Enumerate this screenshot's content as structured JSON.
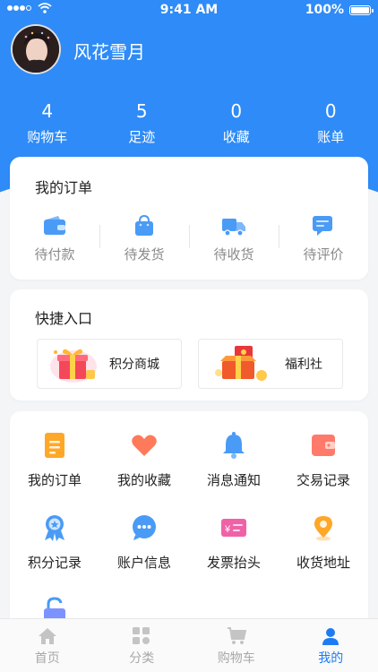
{
  "status_bar": {
    "time": "9:41 AM",
    "battery": "100%"
  },
  "profile": {
    "username": "风花雪月"
  },
  "stats": [
    {
      "value": "4",
      "label": "购物车"
    },
    {
      "value": "5",
      "label": "足迹"
    },
    {
      "value": "0",
      "label": "收藏"
    },
    {
      "value": "0",
      "label": "账单"
    }
  ],
  "orders": {
    "title": "我的订单",
    "items": [
      {
        "label": "待付款",
        "icon": "wallet-icon"
      },
      {
        "label": "待发货",
        "icon": "shopping-bag-icon"
      },
      {
        "label": "待收货",
        "icon": "truck-icon"
      },
      {
        "label": "待评价",
        "icon": "comment-icon"
      }
    ]
  },
  "quick_entry": {
    "title": "快捷入口",
    "items": [
      {
        "label": "积分商城",
        "icon": "gift-box-icon"
      },
      {
        "label": "福利社",
        "icon": "red-envelope-gift-icon"
      }
    ]
  },
  "menu": {
    "items": [
      {
        "label": "我的订单",
        "icon": "document-icon"
      },
      {
        "label": "我的收藏",
        "icon": "heart-icon"
      },
      {
        "label": "消息通知",
        "icon": "bell-icon"
      },
      {
        "label": "交易记录",
        "icon": "wallet-card-icon"
      },
      {
        "label": "积分记录",
        "icon": "medal-icon"
      },
      {
        "label": "账户信息",
        "icon": "chat-bubble-icon"
      },
      {
        "label": "发票抬头",
        "icon": "invoice-icon"
      },
      {
        "label": "收货地址",
        "icon": "location-pin-icon"
      },
      {
        "label": "",
        "icon": "unlock-icon"
      }
    ]
  },
  "tabbar": {
    "items": [
      {
        "label": "首页",
        "icon": "home-icon"
      },
      {
        "label": "分类",
        "icon": "category-grid-icon"
      },
      {
        "label": "购物车",
        "icon": "cart-icon"
      },
      {
        "label": "我的",
        "icon": "person-icon",
        "active": true
      }
    ]
  },
  "colors": {
    "primary": "#2E8BF7",
    "active_tab": "#1E7CF2",
    "background": "#F4F5F7"
  }
}
